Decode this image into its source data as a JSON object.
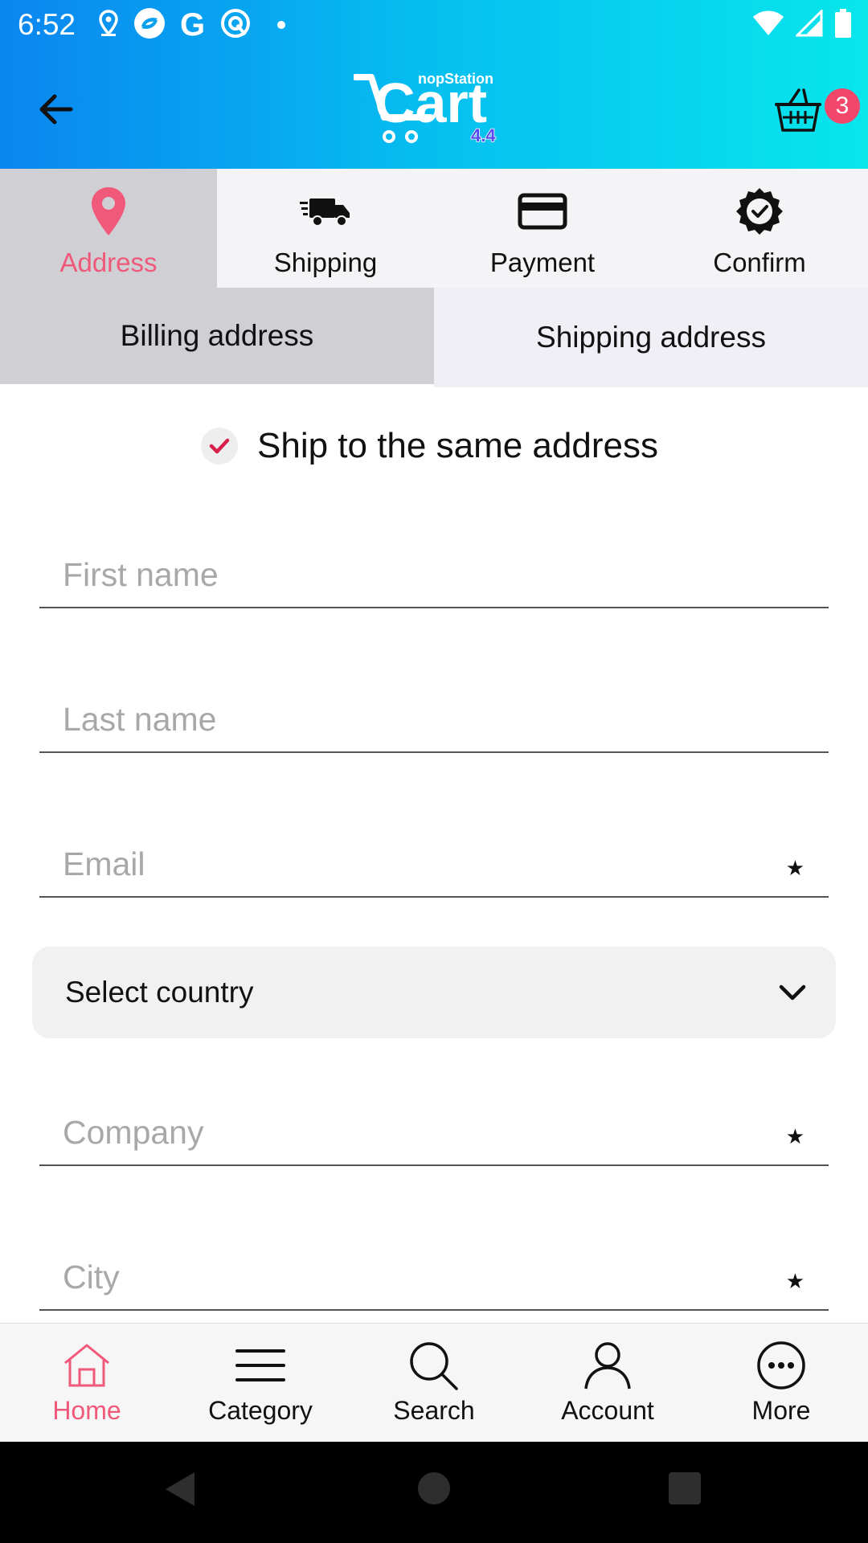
{
  "status_bar": {
    "time": "6:52",
    "left_icons": [
      "location-icon",
      "app-sync-icon",
      "google-g-icon",
      "assistant-icon",
      "notification-dot"
    ],
    "right_icons": [
      "wifi-icon",
      "cell-signal-icon",
      "battery-icon"
    ],
    "g_letter": "G"
  },
  "app_bar": {
    "back_icon": "arrow-back-icon",
    "logo_brand": "nopStation",
    "logo_word": "Cart",
    "logo_version": "4.4",
    "cart_icon": "basket-icon",
    "cart_count": "3"
  },
  "steps": [
    {
      "label": "Address",
      "icon": "location-pin-icon",
      "active": true
    },
    {
      "label": "Shipping",
      "icon": "truck-icon",
      "active": false
    },
    {
      "label": "Payment",
      "icon": "credit-card-icon",
      "active": false
    },
    {
      "label": "Confirm",
      "icon": "badge-check-icon",
      "active": false
    }
  ],
  "address_tabs": {
    "billing": "Billing address",
    "shipping": "Shipping address"
  },
  "ship_same": {
    "label": "Ship to the same address",
    "checked": true
  },
  "form": {
    "first_name": {
      "placeholder": "First name",
      "value": "",
      "required": false
    },
    "last_name": {
      "placeholder": "Last name",
      "value": "",
      "required": false
    },
    "email": {
      "placeholder": "Email",
      "value": "",
      "required": true
    },
    "country": {
      "label": "Select country"
    },
    "company": {
      "placeholder": "Company",
      "value": "",
      "required": true
    },
    "city": {
      "placeholder": "City",
      "value": "",
      "required": true
    },
    "required_mark": "★"
  },
  "bottom_nav": [
    {
      "label": "Home",
      "icon": "home-icon",
      "active": true
    },
    {
      "label": "Category",
      "icon": "menu-lines-icon",
      "active": false
    },
    {
      "label": "Search",
      "icon": "search-icon",
      "active": false
    },
    {
      "label": "Account",
      "icon": "person-icon",
      "active": false
    },
    {
      "label": "More",
      "icon": "more-dots-icon",
      "active": false
    }
  ],
  "colors": {
    "accent": "#f0597a",
    "header_gradient_start": "#0a85f0",
    "header_gradient_end": "#08e6ec",
    "active_tab_bg": "#cfcfd4",
    "badge": "#f2466b",
    "checkmark": "#d8204a"
  }
}
